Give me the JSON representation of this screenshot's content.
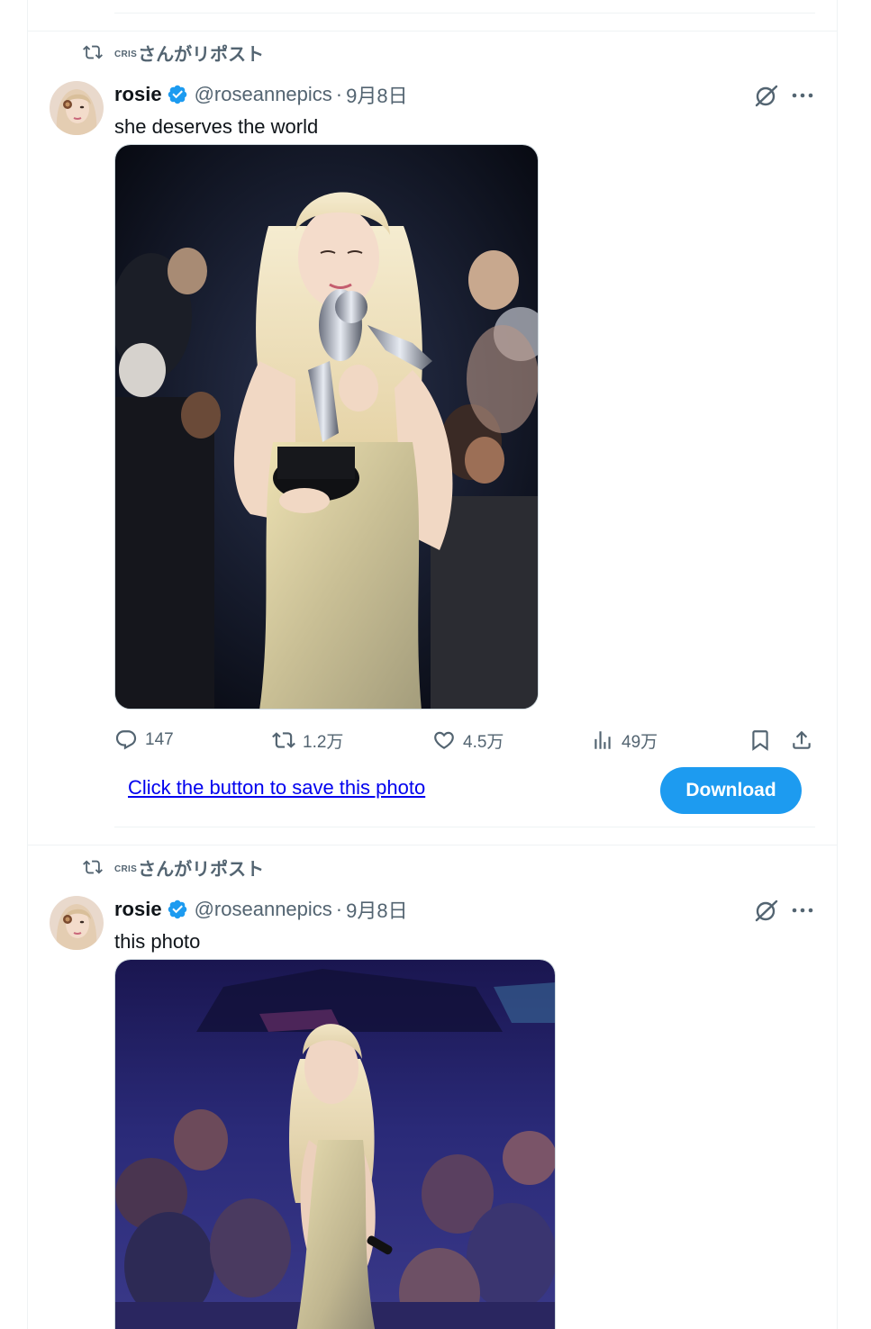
{
  "tweets": [
    {
      "repost_by": "cris",
      "repost_suffix": "さんがリポスト",
      "display_name": "rosie",
      "handle": "@roseannepics",
      "separator": "·",
      "date": "9月8日",
      "text": "she deserves the world",
      "stats": {
        "replies": "147",
        "reposts": "1.2万",
        "likes": "4.5万",
        "views": "49万"
      },
      "save_link": "Click the button to save this photo",
      "download_label": "Download"
    },
    {
      "repost_by": "cris",
      "repost_suffix": "さんがリポスト",
      "display_name": "rosie",
      "handle": "@roseannepics",
      "separator": "·",
      "date": "9月8日",
      "text": "this photo"
    }
  ],
  "icons": [
    "repost-icon",
    "verified-badge-icon",
    "grok-icon",
    "more-icon",
    "reply-icon",
    "retweet-icon",
    "like-icon",
    "views-icon",
    "bookmark-icon",
    "share-icon"
  ],
  "colors": {
    "accent": "#1d9bf0",
    "secondary_text": "#536471",
    "link": "#0000ee"
  }
}
